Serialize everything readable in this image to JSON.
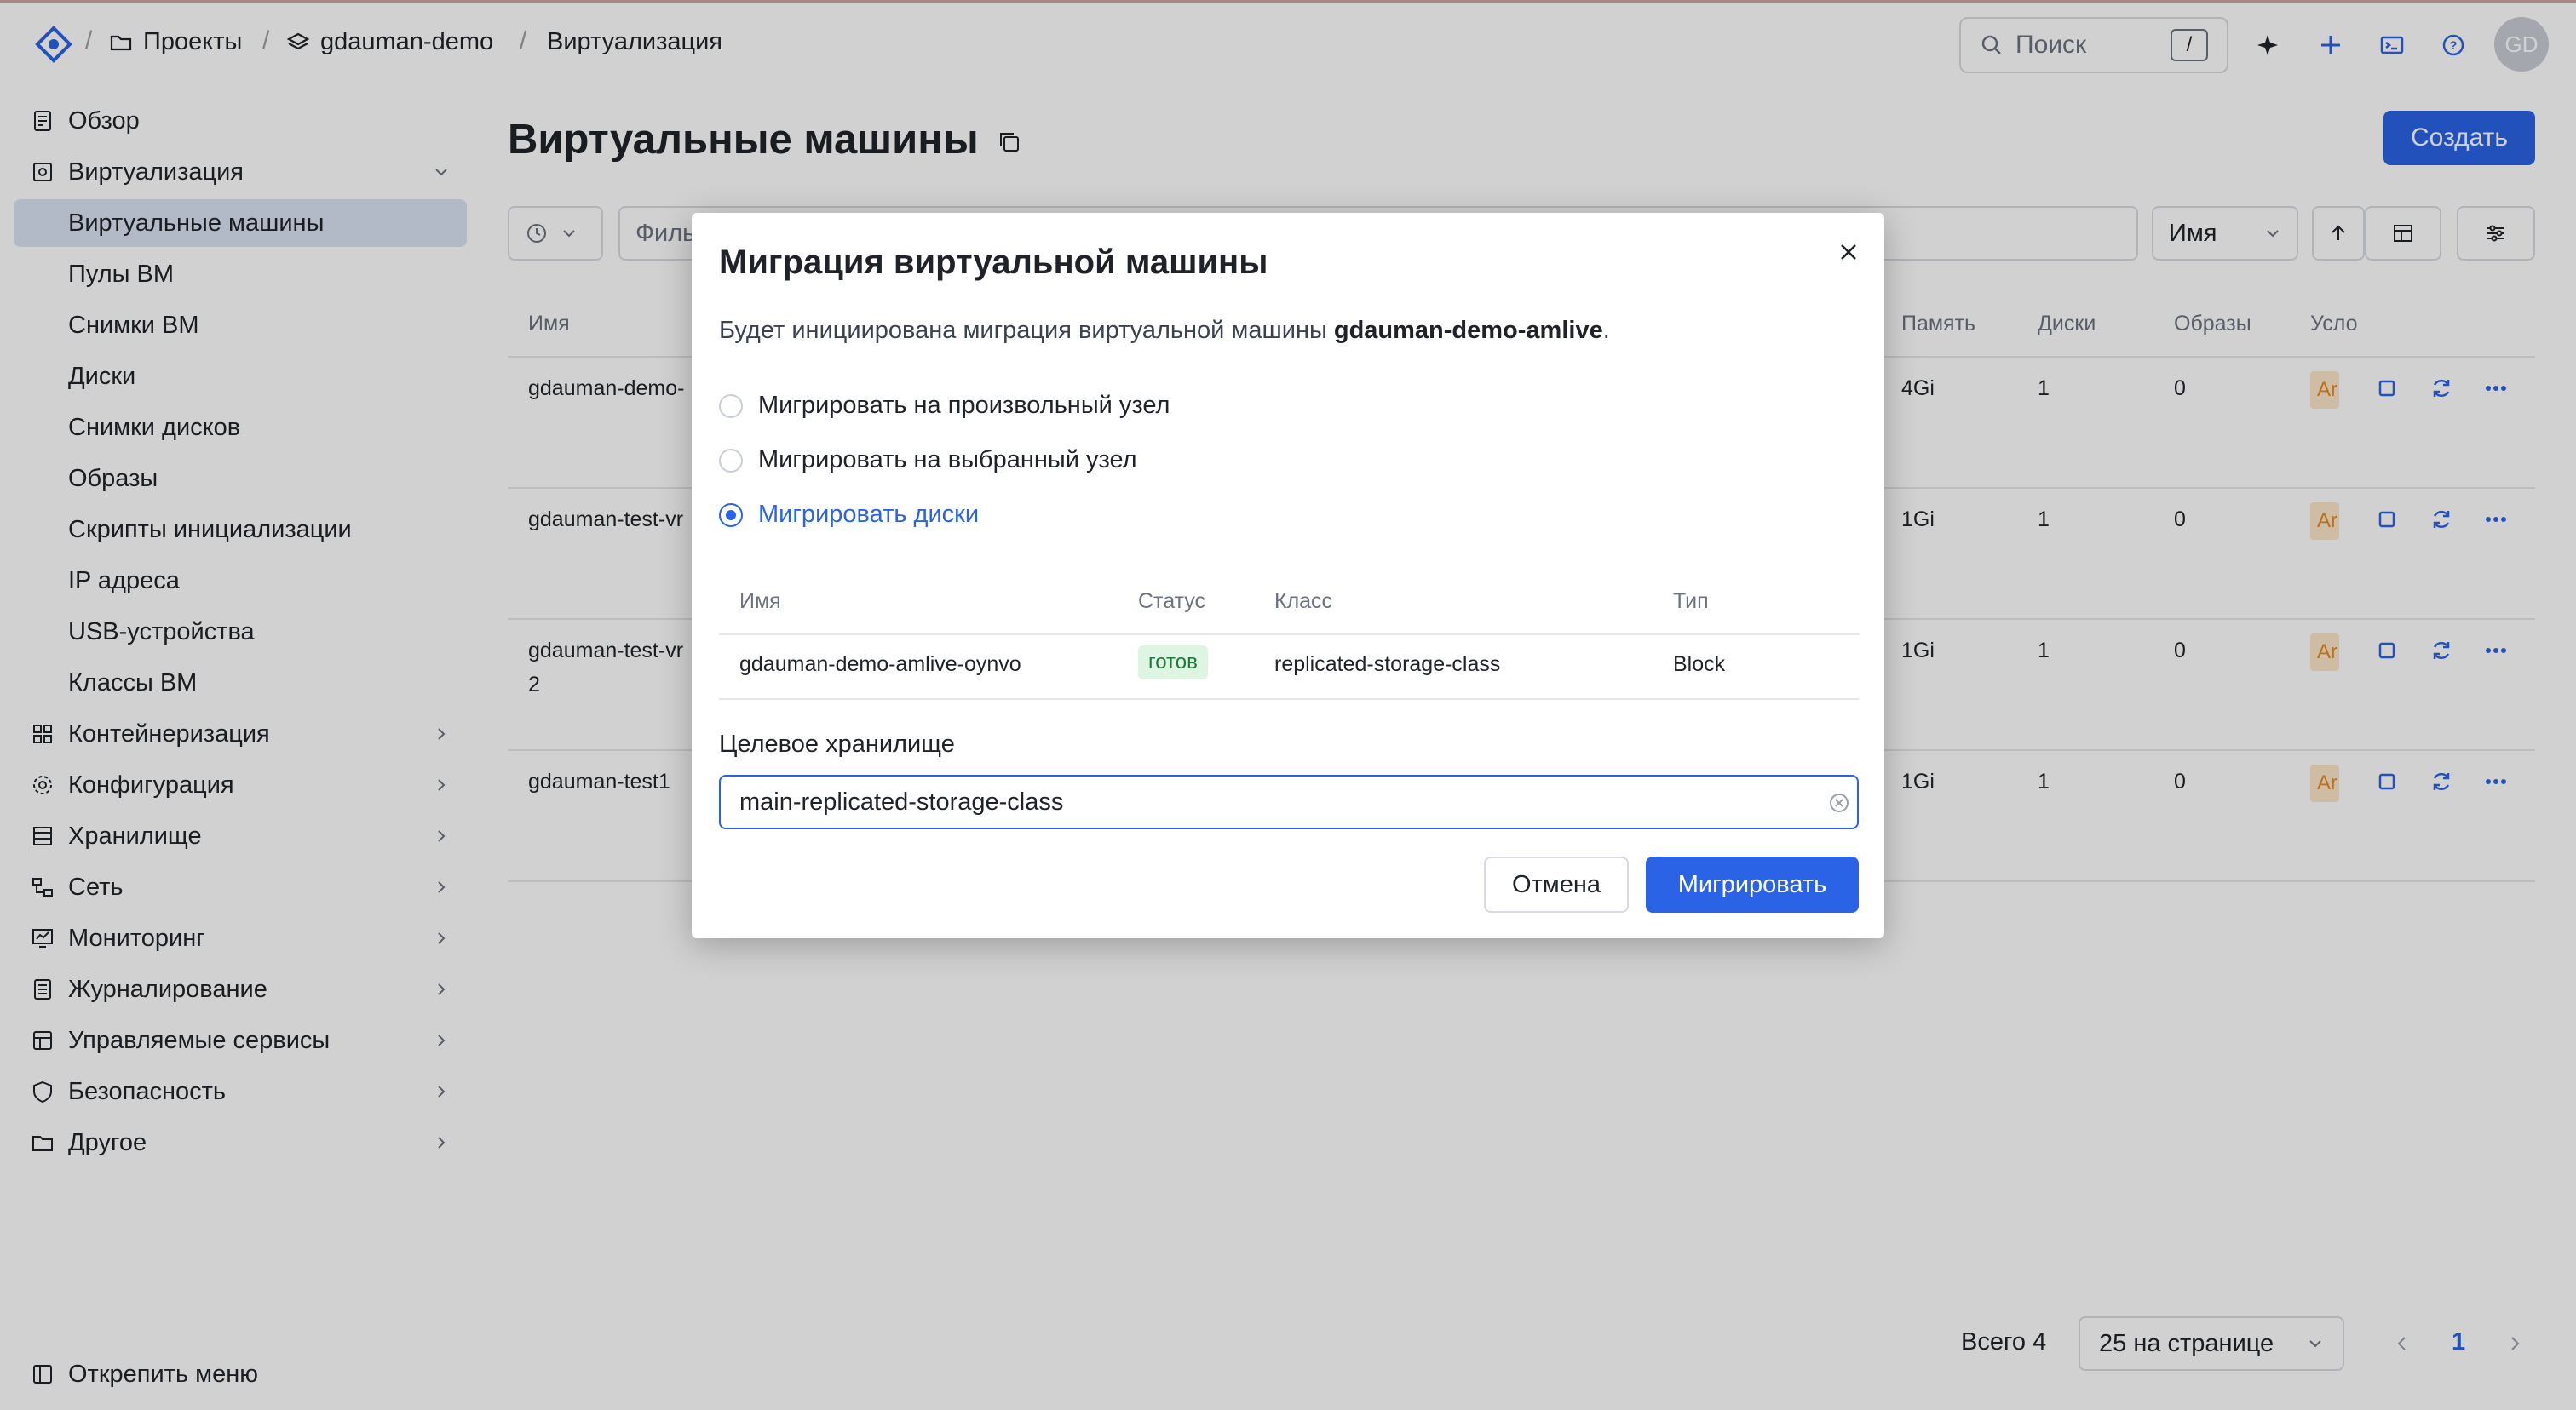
{
  "breadcrumb": {
    "projects": "Проекты",
    "project": "gdauman-demo",
    "section": "Виртуализация",
    "separator": "/"
  },
  "topbar": {
    "search_placeholder": "Поиск",
    "search_shortcut": "/",
    "avatar_initials": "GD"
  },
  "sidebar": {
    "items": [
      {
        "label": "Обзор"
      },
      {
        "label": "Виртуализация"
      },
      {
        "label": "Виртуальные машины"
      },
      {
        "label": "Пулы ВМ"
      },
      {
        "label": "Снимки ВМ"
      },
      {
        "label": "Диски"
      },
      {
        "label": "Снимки дисков"
      },
      {
        "label": "Образы"
      },
      {
        "label": "Скрипты инициализации"
      },
      {
        "label": "IP адреса"
      },
      {
        "label": "USB-устройства"
      },
      {
        "label": "Классы ВМ"
      },
      {
        "label": "Контейнеризация"
      },
      {
        "label": "Конфигурация"
      },
      {
        "label": "Хранилище"
      },
      {
        "label": "Сеть"
      },
      {
        "label": "Мониторинг"
      },
      {
        "label": "Журналирование"
      },
      {
        "label": "Управляемые сервисы"
      },
      {
        "label": "Безопасность"
      },
      {
        "label": "Другое"
      }
    ],
    "unpin_label": "Открепить меню"
  },
  "page": {
    "title": "Виртуальные машины",
    "create_label": "Создать",
    "filter_placeholder": "Филь",
    "sort_label": "Имя",
    "columns": {
      "name": "Имя",
      "memory": "Память",
      "disks": "Диски",
      "images": "Образы",
      "conditions": "Усло"
    },
    "rows": [
      {
        "name": "gdauman-demo-",
        "name2": "",
        "memory": "4Gi",
        "disks": "1",
        "images": "0",
        "cond": "Ar"
      },
      {
        "name": "gdauman-test-vr",
        "name2": "",
        "memory": "1Gi",
        "disks": "1",
        "images": "0",
        "cond": "Ar"
      },
      {
        "name": "gdauman-test-vr",
        "name2": "2",
        "memory": "1Gi",
        "disks": "1",
        "images": "0",
        "cond": "Ar"
      },
      {
        "name": "gdauman-test1",
        "name2": "",
        "memory": "1Gi",
        "disks": "1",
        "images": "0",
        "cond": "Ar"
      }
    ],
    "pager": {
      "total": "Всего 4",
      "per_page": "25 на странице",
      "current": "1"
    }
  },
  "modal": {
    "title": "Миграция виртуальной машины",
    "desc_prefix": "Будет инициирована миграция виртуальной машины ",
    "vm_name": "gdauman-demo-amlive",
    "desc_suffix": ".",
    "options": [
      {
        "label": "Мигрировать на произвольный узел"
      },
      {
        "label": "Мигрировать на выбранный узел"
      },
      {
        "label": "Мигрировать диски"
      }
    ],
    "table": {
      "headers": {
        "name": "Имя",
        "status": "Статус",
        "class": "Класс",
        "type": "Тип"
      },
      "row": {
        "name": "gdauman-demo-amlive-oynvo",
        "status": "готов",
        "class": "replicated-storage-class",
        "type": "Block"
      }
    },
    "target_label": "Целевое хранилище",
    "target_value": "main-replicated-storage-class",
    "cancel_label": "Отмена",
    "submit_label": "Мигрировать"
  },
  "colors": {
    "accent": "#2b63e6",
    "active_nav": "#dbe3f3",
    "ready_badge_bg": "#def5e3",
    "ready_badge_fg": "#1c7a3a"
  }
}
